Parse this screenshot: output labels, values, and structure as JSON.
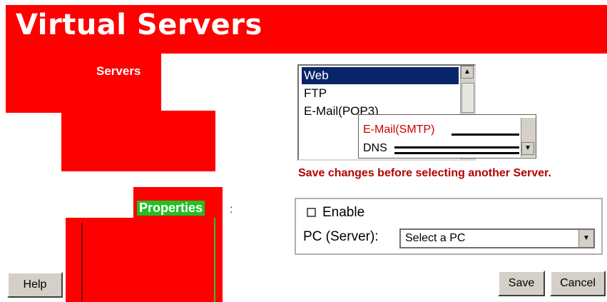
{
  "header": {
    "title": "Virtual Servers"
  },
  "nav": {
    "servers_label": "Servers",
    "properties_label": "Properties"
  },
  "server_list": {
    "items": [
      "Web",
      "FTP",
      "E-Mail(POP3)"
    ],
    "selected": "Web"
  },
  "popup_list": {
    "items": [
      "E-Mail(SMTP)",
      "DNS"
    ]
  },
  "warning": "Save changes before selecting another Server.",
  "properties": {
    "enable_label": "Enable",
    "enable_checked": false,
    "pc_label": "PC (Server):",
    "pc_select_value": "Select a PC"
  },
  "buttons": {
    "help": "Help",
    "save": "Save",
    "cancel": "Cancel"
  },
  "colors": {
    "accent": "#ff0000",
    "selection": "#0a246a",
    "warning": "#b40000",
    "properties_tab": "#22c022"
  }
}
